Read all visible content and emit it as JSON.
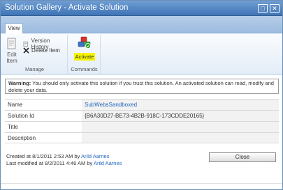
{
  "window": {
    "title": "Solution Gallery - Activate Solution",
    "title_buttons": [
      "□",
      "✕"
    ]
  },
  "ribbon": {
    "tabs": [
      {
        "label": "View",
        "selected": true
      }
    ],
    "groups": [
      {
        "label": "Manage",
        "edit_item_label_line1": "Edit",
        "edit_item_label_line2": "Item",
        "version_history_label": "Version History",
        "delete_item_label": "Delete Item"
      },
      {
        "label": "Commands",
        "activate_label": "Activate"
      }
    ]
  },
  "warning": {
    "prefix": "Warning:",
    "text": " You should only activate this solution if you trust this solution. An activated solution can read, modify and delete your data."
  },
  "form": {
    "rows": [
      {
        "label": "Name",
        "value": "SubWebsSandboxed",
        "is_link": true
      },
      {
        "label": "Solution Id",
        "value": "{B6A30D27-BE73-4B2B-918C-173CDDE20165}",
        "is_link": false
      },
      {
        "label": "Title",
        "value": "",
        "is_link": false
      },
      {
        "label": "Description",
        "value": "",
        "is_link": false
      }
    ]
  },
  "footer": {
    "created_prefix": "Created at 8/1/2011 2:53 AM  by ",
    "created_by": "Arild Aarnes",
    "modified_prefix": "Last modified at 8/2/2011 4:46 AM  by ",
    "modified_by": "Arild Aarnes",
    "close_label": "Close"
  },
  "colors": {
    "titlebar": "#4f85c4",
    "link": "#2266bb",
    "highlight": "#f6f400"
  },
  "icons": {
    "edit_item": "edit-document-icon",
    "version_history": "version-history-icon",
    "delete_item": "delete-x-icon",
    "activate": "activate-cubes-icon"
  }
}
